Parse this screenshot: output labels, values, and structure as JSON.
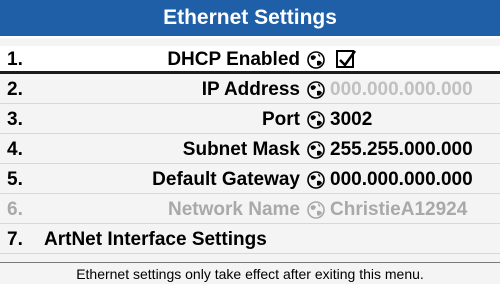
{
  "title": "Ethernet Settings",
  "rows": [
    {
      "num": "1.",
      "label": "DHCP Enabled",
      "checked": true
    },
    {
      "num": "2.",
      "label": "IP Address",
      "value": "000.000.000.000"
    },
    {
      "num": "3.",
      "label": "Port",
      "value": "3002"
    },
    {
      "num": "4.",
      "label": "Subnet Mask",
      "value": "255.255.000.000"
    },
    {
      "num": "5.",
      "label": "Default Gateway",
      "value": "000.000.000.000"
    },
    {
      "num": "6.",
      "label": "Network Name",
      "value": "ChristieA12924"
    },
    {
      "num": "7.",
      "label": "ArtNet Interface Settings"
    }
  ],
  "footer": "Ethernet settings only take effect after exiting this menu.",
  "colors": {
    "title_bar": "#1e5fa8",
    "disabled_text": "#a9a9a9",
    "dim_value": "#c0c0c0"
  },
  "icons": {
    "network": "globe-network-icon",
    "checkbox": "checkmark-icon"
  }
}
